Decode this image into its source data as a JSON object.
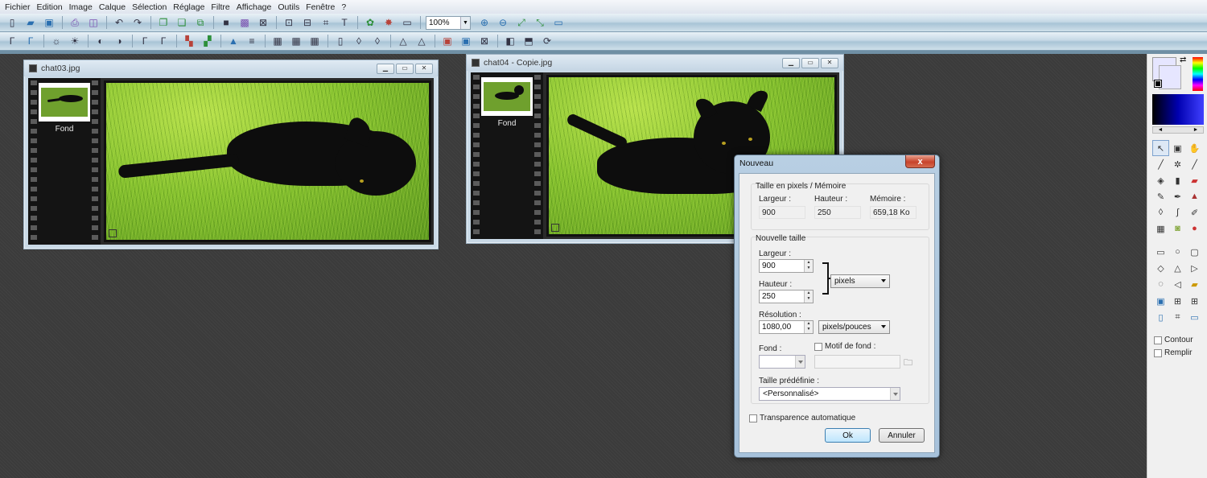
{
  "menu": [
    "Fichier",
    "Edition",
    "Image",
    "Calque",
    "Sélection",
    "Réglage",
    "Filtre",
    "Affichage",
    "Outils",
    "Fenêtre",
    "?"
  ],
  "toolbar": {
    "zoom_value": "100%"
  },
  "colors": {
    "workspace": "#3b3b3b",
    "titlebar": "#c5d6e4",
    "dialog_close": "#c8432b"
  },
  "windows": [
    {
      "title": "chat03.jpg",
      "layer_name": "Fond"
    },
    {
      "title": "chat04 - Copie.jpg",
      "layer_name": "Fond"
    }
  ],
  "dialog": {
    "title": "Nouveau",
    "close_glyph": "x",
    "size_group": {
      "title": "Taille en pixels / Mémoire",
      "width_label": "Largeur :",
      "height_label": "Hauteur :",
      "memory_label": "Mémoire :",
      "width_value": "900",
      "height_value": "250",
      "memory_value": "659,18 Ko"
    },
    "new_size": {
      "title": "Nouvelle taille",
      "width_label": "Largeur :",
      "width_value": "900",
      "height_label": "Hauteur :",
      "height_value": "250",
      "unit": "pixels",
      "resolution_label": "Résolution :",
      "resolution_value": "1080,00",
      "resolution_unit": "pixels/pouces",
      "background_label": "Fond :",
      "pattern_label": "Motif de fond :",
      "preset_label": "Taille prédéfinie :",
      "preset_value": "<Personnalisé>"
    },
    "auto_transparency_label": "Transparence automatique",
    "ok_label": "Ok",
    "cancel_label": "Annuler"
  },
  "toolpanel": {
    "contour_label": "Contour",
    "fill_label": "Remplir"
  }
}
